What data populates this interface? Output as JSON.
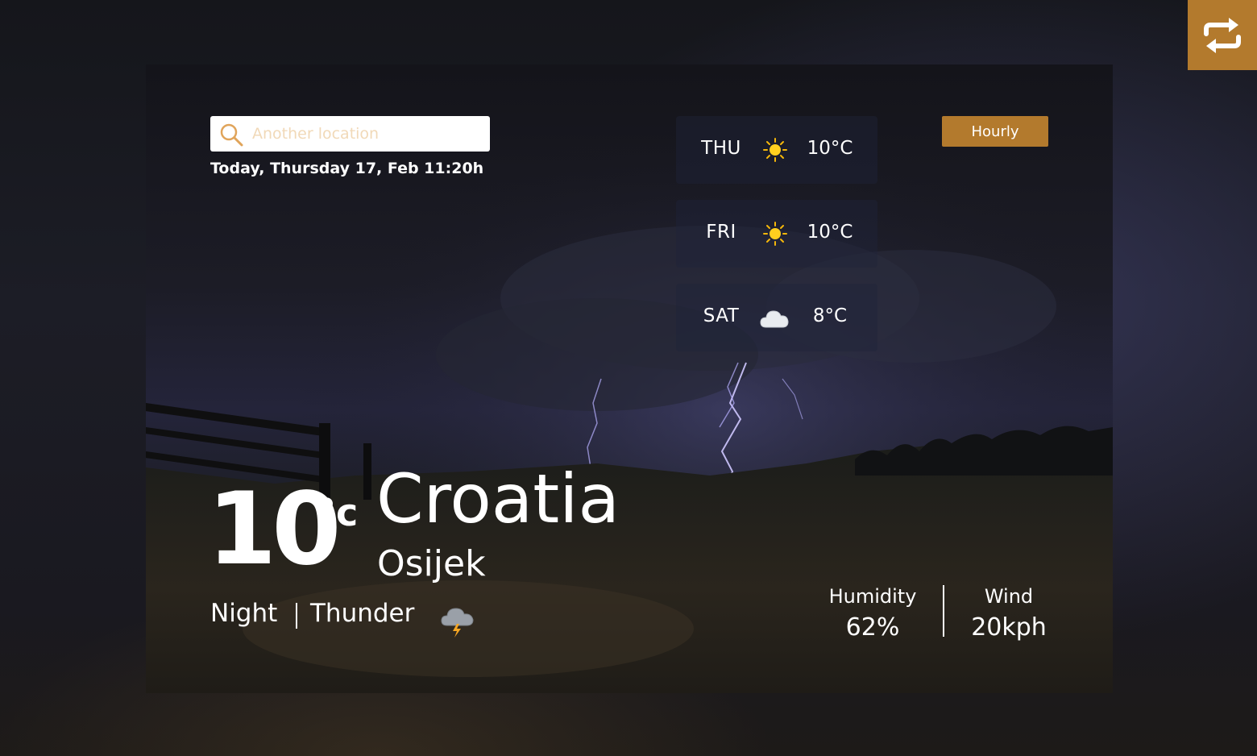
{
  "colors": {
    "accent": "#b37a2d",
    "text": "#ffffff",
    "placeholder": "#f1d9b8"
  },
  "search": {
    "placeholder": "Another location",
    "icon": "search-icon"
  },
  "date_line": "Today, Thursday 17, Feb 11:20h",
  "forecast": [
    {
      "day": "THU",
      "icon": "sun-icon",
      "temp": "10°C"
    },
    {
      "day": "FRI",
      "icon": "sun-icon",
      "temp": "10°C"
    },
    {
      "day": "SAT",
      "icon": "cloud-icon",
      "temp": "8°C"
    }
  ],
  "hourly_label": "Hourly",
  "current": {
    "temp": "10",
    "unit": "°c",
    "country": "Croatia",
    "city": "Osijek",
    "time_of_day": "Night",
    "condition": "Thunder",
    "condition_icon": "thunderstorm-icon"
  },
  "stats": {
    "humidity_label": "Humidity",
    "humidity_value": "62%",
    "wind_label": "Wind",
    "wind_value": "20kph"
  },
  "toggle_icon": "swap-arrows-icon"
}
